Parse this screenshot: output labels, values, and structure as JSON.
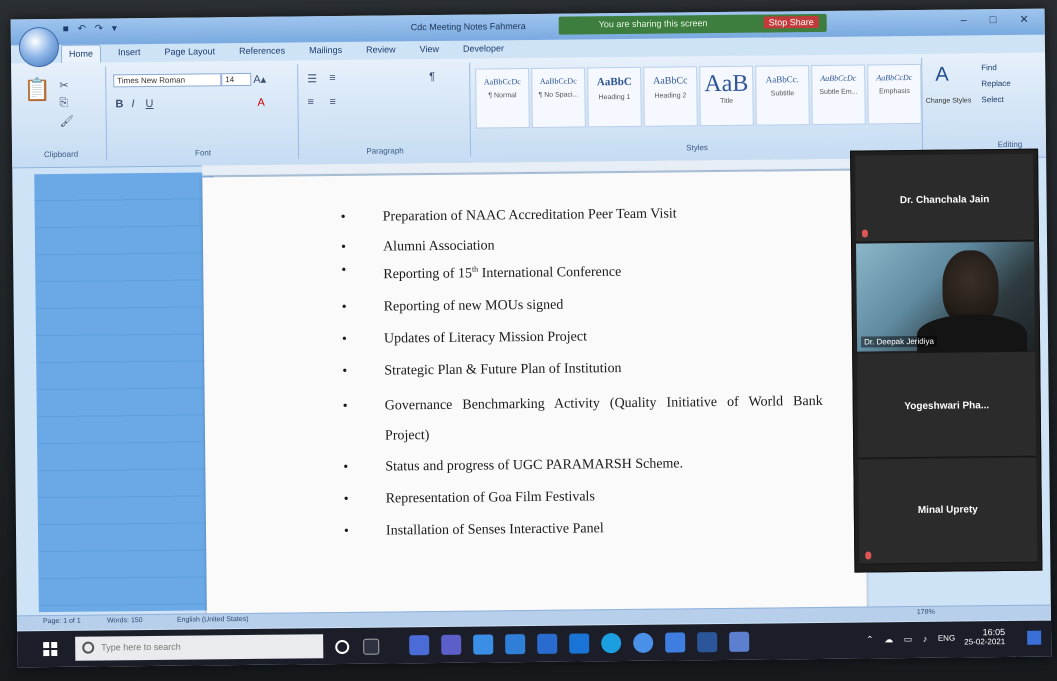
{
  "window": {
    "title": "Cdc Meeting Notes Fahmera",
    "quick_access": "■ ↶ ↷ ▾",
    "controls": "– □ ✕"
  },
  "teams_share": {
    "status": "You are sharing this screen",
    "stop_label": "Stop Share"
  },
  "ribbon": {
    "tabs": [
      "Home",
      "Insert",
      "Page Layout",
      "References",
      "Mailings",
      "Review",
      "View",
      "Developer"
    ],
    "font_name": "Times New Roman",
    "font_size": "14",
    "groups": [
      "Clipboard",
      "Font",
      "Paragraph",
      "Styles",
      "Editing"
    ],
    "styles": [
      {
        "sample": "AaBbCcDc",
        "label": "¶ Normal"
      },
      {
        "sample": "AaBbCcDc",
        "label": "¶ No Spaci..."
      },
      {
        "sample": "AaBbC",
        "label": "Heading 1"
      },
      {
        "sample": "AaBbCc",
        "label": "Heading 2"
      },
      {
        "sample": "AaB",
        "label": "Title"
      },
      {
        "sample": "AaBbCc.",
        "label": "Subtitle"
      },
      {
        "sample": "AaBbCcDc",
        "label": "Subtle Em..."
      },
      {
        "sample": "AaBbCcDc",
        "label": "Emphasis"
      }
    ],
    "change_styles": "Change Styles",
    "editing": [
      "Find",
      "Replace",
      "Select"
    ]
  },
  "document": {
    "agenda": [
      {
        "text": "Preparation of NAAC Accreditation Peer Team Visit"
      },
      {
        "text": "Alumni Association"
      },
      {
        "text_before": "Reporting of 15",
        "sup": "th",
        "text_after": " International Conference"
      },
      {
        "text": "Reporting of new MOUs signed"
      },
      {
        "text": "Updates of Literacy Mission Project"
      },
      {
        "text": "Strategic Plan & Future Plan of Institution"
      },
      {
        "text": "Governance Benchmarking Activity (Quality Initiative of World Bank Project)"
      },
      {
        "text": "Status and progress of UGC PARAMARSH Scheme."
      },
      {
        "text": "Representation of Goa Film Festivals"
      },
      {
        "text": "Installation of Senses Interactive Panel"
      }
    ]
  },
  "participants": [
    {
      "name": "Dr. Chanchala Jain"
    },
    {
      "name": "Dr. Deepak Jeridiya",
      "video": true
    },
    {
      "name": "Yogeshwari Pha..."
    },
    {
      "name": "Minal Uprety"
    }
  ],
  "statusbar": {
    "page": "Page: 1 of 1",
    "words": "Words: 150",
    "language": "English (United States)",
    "zoom": "178%"
  },
  "taskbar": {
    "search_placeholder": "Type here to search",
    "language": "ENG",
    "time": "16:05",
    "date": "25-02-2021"
  }
}
